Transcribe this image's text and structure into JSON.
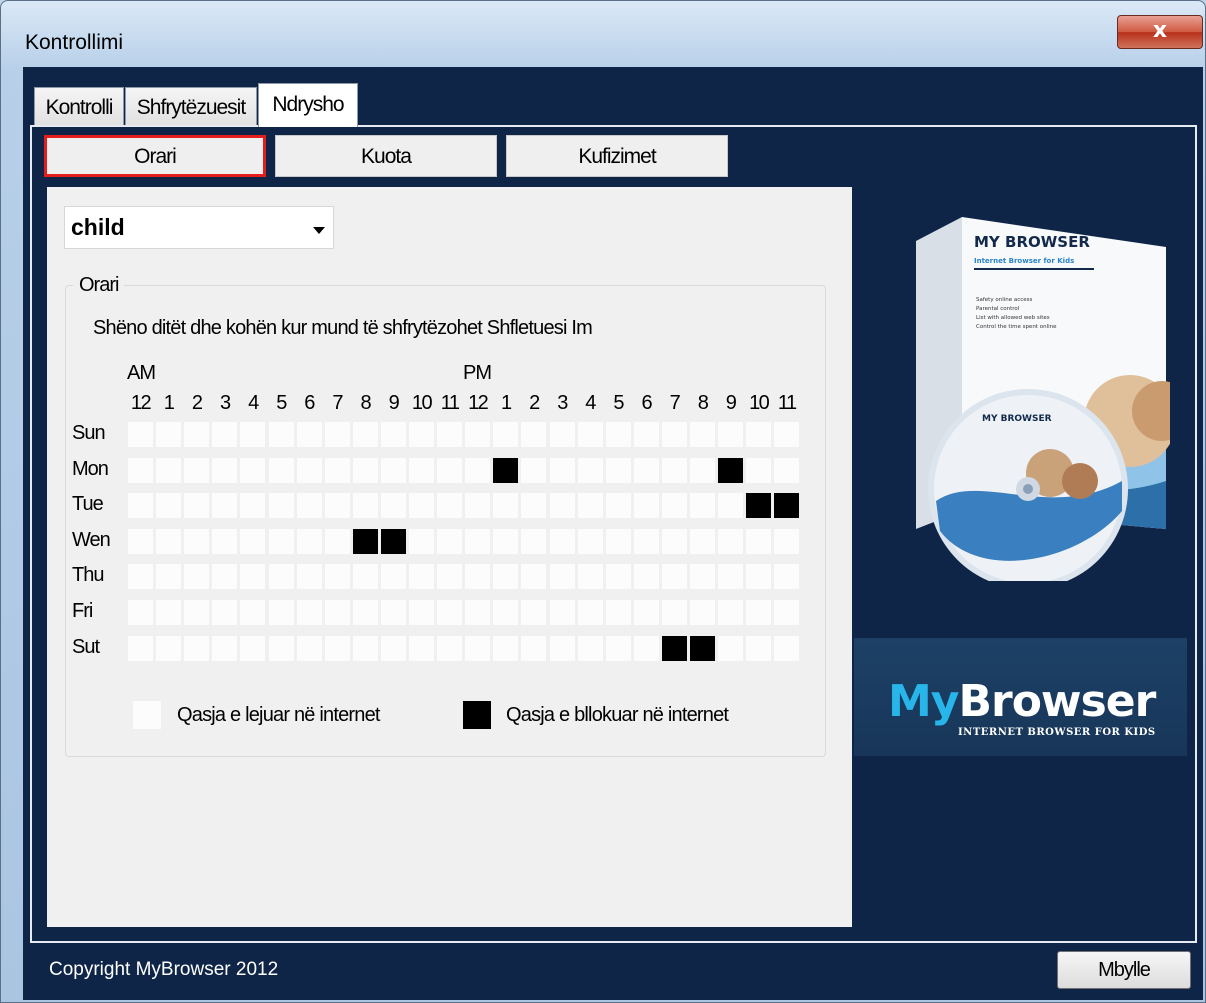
{
  "window": {
    "title": "Kontrollimi",
    "close_glyph": "x"
  },
  "tabs": [
    {
      "label": "Kontrolli",
      "active": false
    },
    {
      "label": "Shfrytëzuesit",
      "active": false
    },
    {
      "label": "Ndrysho",
      "active": true
    }
  ],
  "subtabs": [
    {
      "label": "Orari",
      "selected": true
    },
    {
      "label": "Kuota",
      "selected": false
    },
    {
      "label": "Kufizimet",
      "selected": false
    }
  ],
  "user_select": {
    "value": "child"
  },
  "schedule": {
    "group_title": "Orari",
    "instruction": "Shëno ditët dhe kohën kur mund të shfrytëzohet Shfletuesi Im",
    "am_label": "AM",
    "pm_label": "PM",
    "hours": [
      "12",
      "1",
      "2",
      "3",
      "4",
      "5",
      "6",
      "7",
      "8",
      "9",
      "10",
      "11",
      "12",
      "1",
      "2",
      "3",
      "4",
      "5",
      "6",
      "7",
      "8",
      "9",
      "10",
      "11"
    ],
    "days": [
      {
        "label": "Sun",
        "blocked_hours": []
      },
      {
        "label": "Mon",
        "blocked_hours": [
          13,
          21
        ]
      },
      {
        "label": "Tue",
        "blocked_hours": [
          22,
          23
        ]
      },
      {
        "label": "Wen",
        "blocked_hours": [
          8,
          9
        ]
      },
      {
        "label": "Thu",
        "blocked_hours": []
      },
      {
        "label": "Fri",
        "blocked_hours": []
      },
      {
        "label": "Sut",
        "blocked_hours": [
          19,
          20
        ]
      }
    ],
    "legend_allowed": "Qasja e lejuar në internet",
    "legend_blocked": "Qasja e bllokuar në internet"
  },
  "promo": {
    "box_title": "MY BROWSER",
    "box_subtitle": "Internet Browser for Kids",
    "box_bullets": [
      "Safety online access",
      "Parental control",
      "List with allowed web sites",
      "Control the time spent online"
    ],
    "logo_my": "My",
    "logo_browser": "Browser",
    "logo_tagline": "INTERNET BROWSER FOR KIDS"
  },
  "footer": {
    "copyright": "Copyright MyBrowser 2012",
    "close_label": "Mbylle"
  },
  "colors": {
    "accent_red": "#e41d1d",
    "navy": "#0e2547",
    "logo_cyan": "#27b5ea",
    "blocked": "#000000",
    "allowed": "#fcfcfc"
  }
}
